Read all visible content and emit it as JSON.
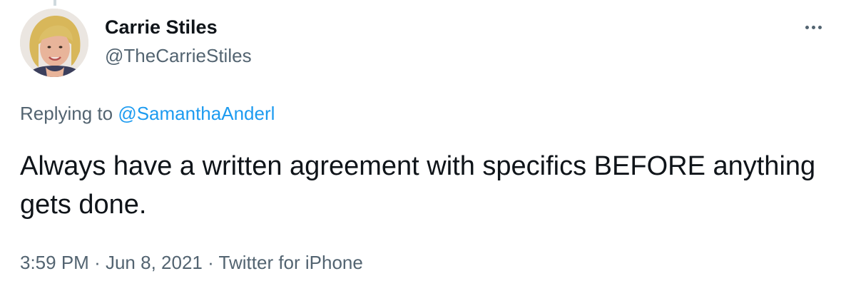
{
  "author": {
    "display_name": "Carrie Stiles",
    "handle": "@TheCarrieStiles"
  },
  "reply": {
    "prefix": "Replying to",
    "mention": "@SamanthaAnderl"
  },
  "tweet": {
    "text": "Always have a written agreement with specifics BEFORE anything gets done."
  },
  "meta": {
    "time": "3:59 PM",
    "separator": "·",
    "date": "Jun 8, 2021",
    "source": "Twitter for iPhone"
  },
  "icons": {
    "more": "more-horizontal-icon"
  },
  "colors": {
    "text_primary": "#0f1419",
    "text_secondary": "#536471",
    "link": "#1d9bf0"
  }
}
